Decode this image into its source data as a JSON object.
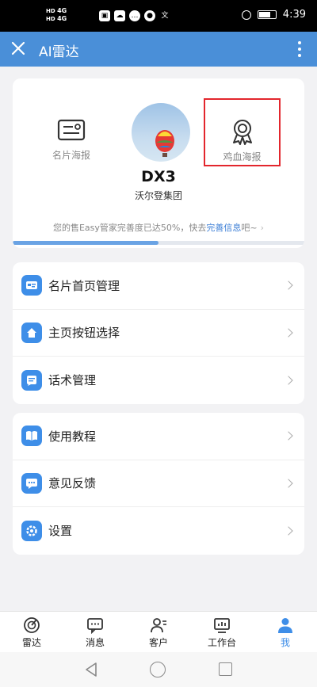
{
  "status_bar": {
    "network_1": "HD",
    "network_2": "HD",
    "signal_1": "4G",
    "signal_2": "4G",
    "time": "4:39"
  },
  "app_bar": {
    "title": "AI雷达"
  },
  "profile": {
    "left_poster_label": "名片海报",
    "right_poster_label": "鸡血海报",
    "name": "DX3",
    "company": "沃尔登集团",
    "progress_text_before": "您的售Easy管家完善度已达50%，快去",
    "progress_link": "完善信息",
    "progress_text_after": "吧~",
    "progress_percent": 50
  },
  "menu_group_1": [
    {
      "label": "名片首页管理",
      "icon": "card-icon"
    },
    {
      "label": "主页按钮选择",
      "icon": "home-icon"
    },
    {
      "label": "话术管理",
      "icon": "script-icon"
    }
  ],
  "menu_group_2": [
    {
      "label": "使用教程",
      "icon": "book-icon"
    },
    {
      "label": "意见反馈",
      "icon": "feedback-icon"
    },
    {
      "label": "设置",
      "icon": "gear-icon"
    }
  ],
  "bottom_nav": [
    {
      "label": "雷达",
      "icon": "radar-icon"
    },
    {
      "label": "消息",
      "icon": "message-icon"
    },
    {
      "label": "客户",
      "icon": "customer-icon"
    },
    {
      "label": "工作台",
      "icon": "workbench-icon"
    },
    {
      "label": "我",
      "icon": "me-icon",
      "active": true
    }
  ],
  "colors": {
    "primary": "#4a8fd8",
    "accent": "#3e8ee8",
    "highlight_border": "#e3262d"
  }
}
